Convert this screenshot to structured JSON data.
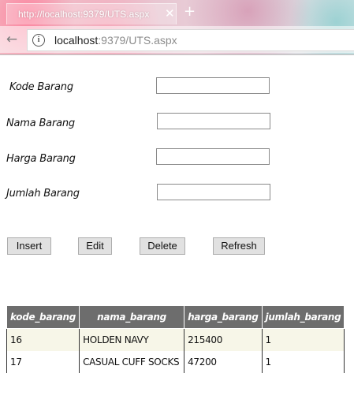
{
  "browser": {
    "tab_title": "http://localhost:9379/UTS.aspx",
    "tab_close": "✕",
    "new_tab": "+",
    "back": "←",
    "url_host": "localhost",
    "url_rest": ":9379/UTS.aspx",
    "info": "i"
  },
  "form": {
    "kode_label": "Kode Barang",
    "nama_label": "Nama Barang",
    "harga_label": "Harga Barang",
    "jumlah_label": "Jumlah Barang",
    "kode_value": "",
    "nama_value": "",
    "harga_value": "",
    "jumlah_value": ""
  },
  "buttons": {
    "insert": "Insert",
    "edit": "Edit",
    "delete": "Delete",
    "refresh": "Refresh"
  },
  "grid": {
    "headers": [
      "kode_barang",
      "nama_barang",
      "harga_barang",
      "jumlah_barang"
    ],
    "rows": [
      [
        "16",
        "HOLDEN NAVY",
        "215400",
        "1"
      ],
      [
        "17",
        "CASUAL CUFF SOCKS",
        "47200",
        "1"
      ]
    ]
  }
}
